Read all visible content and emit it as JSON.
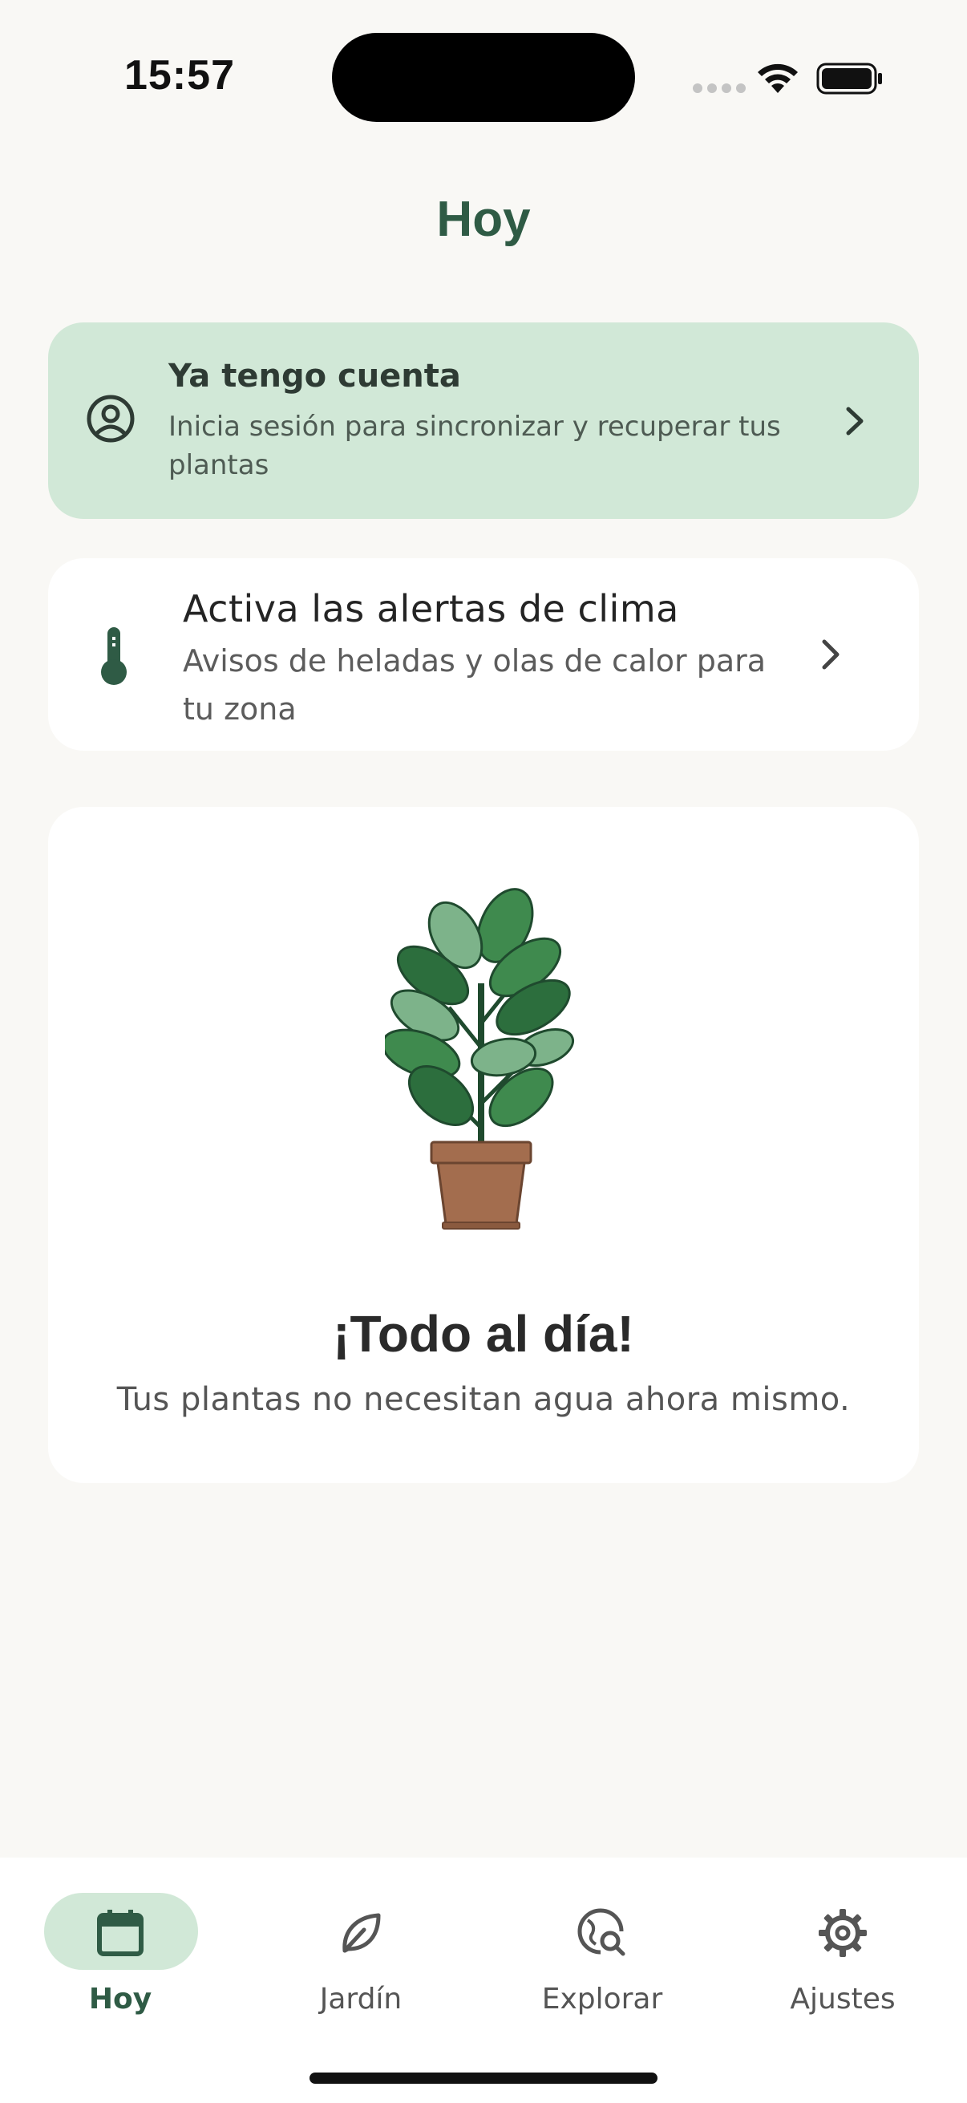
{
  "status_bar": {
    "time": "15:57"
  },
  "header": {
    "title": "Hoy"
  },
  "account_card": {
    "title": "Ya tengo cuenta",
    "subtitle": "Inicia sesión para sincronizar y recuperar tus plantas"
  },
  "weather_card": {
    "title": "Activa las alertas de clima",
    "subtitle": "Avisos de heladas y olas de calor para tu zona"
  },
  "empty_state": {
    "title": "¡Todo al día!",
    "subtitle": "Tus plantas no necesitan agua ahora mismo."
  },
  "tabs": [
    {
      "label": "Hoy",
      "icon": "calendar-icon",
      "active": true
    },
    {
      "label": "Jardín",
      "icon": "leaf-icon",
      "active": false
    },
    {
      "label": "Explorar",
      "icon": "explore-search-icon",
      "active": false
    },
    {
      "label": "Ajustes",
      "icon": "gear-icon",
      "active": false
    }
  ],
  "colors": {
    "accent": "#2f5b45",
    "accent_light": "#d1e8d7",
    "background": "#f9f8f5"
  }
}
